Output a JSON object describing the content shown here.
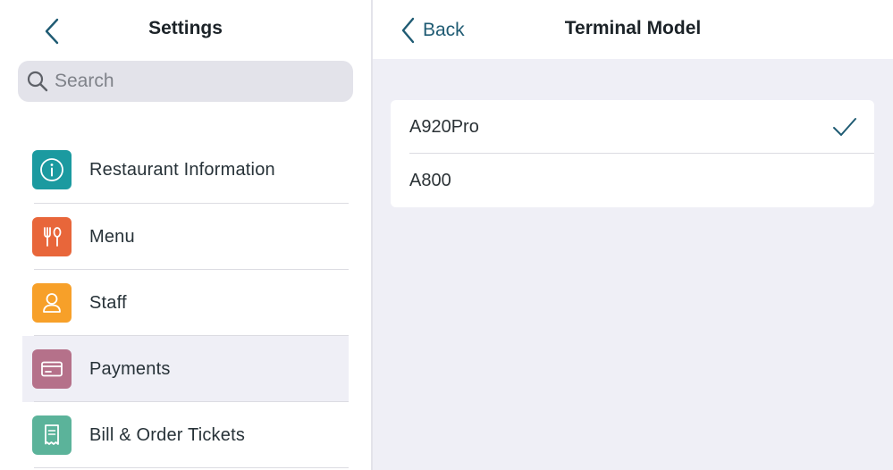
{
  "settings": {
    "title": "Settings",
    "search": {
      "placeholder": "Search",
      "value": ""
    },
    "items": [
      {
        "label": "Restaurant Information",
        "icon": "info-icon",
        "color": "#1b9aa0"
      },
      {
        "label": "Menu",
        "icon": "fork-knife-icon",
        "color": "#e8663a"
      },
      {
        "label": "Staff",
        "icon": "person-icon",
        "color": "#f7a029"
      },
      {
        "label": "Payments",
        "icon": "card-icon",
        "color": "#b5718a",
        "selected": true
      },
      {
        "label": "Bill & Order Tickets",
        "icon": "receipt-icon",
        "color": "#5bb39a"
      }
    ]
  },
  "terminal": {
    "back_label": "Back",
    "title": "Terminal Model",
    "options": [
      {
        "label": "A920Pro",
        "selected": true
      },
      {
        "label": "A800",
        "selected": false
      }
    ]
  },
  "colors": {
    "accent": "#1f5b73",
    "selected_row_bg": "#efeff6",
    "pane_bg": "#efeff6"
  }
}
